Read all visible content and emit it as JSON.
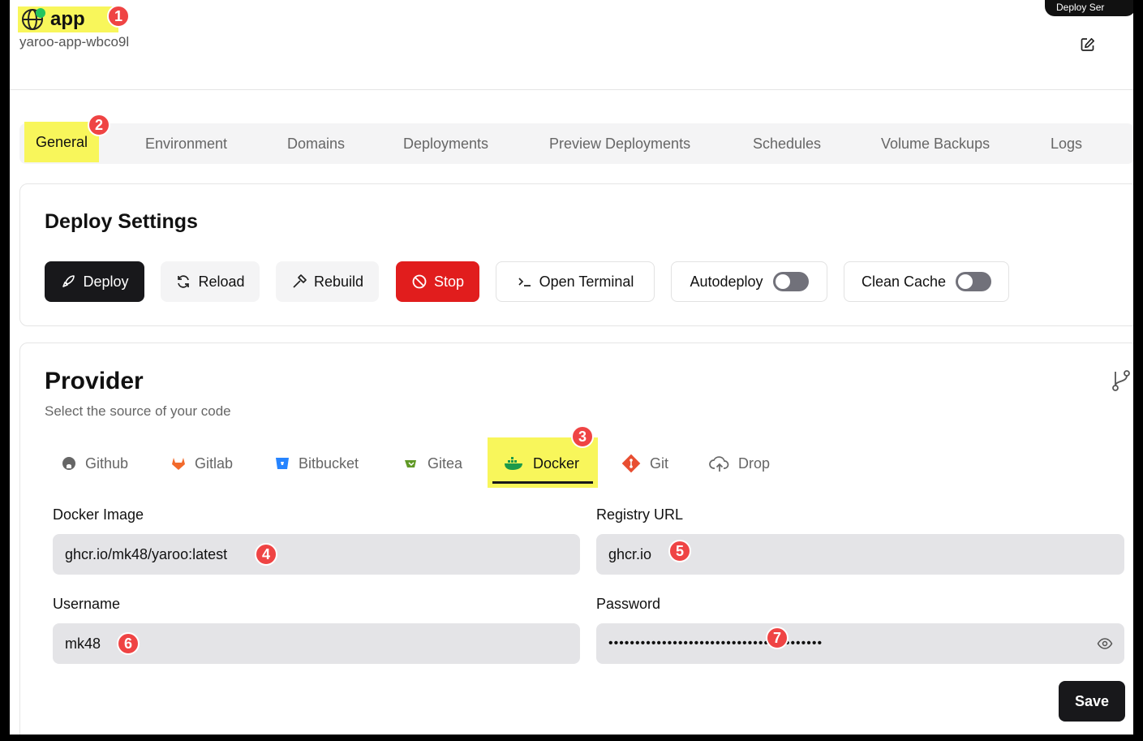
{
  "header": {
    "app_name": "app",
    "app_slug": "yaroo-app-wbco9l",
    "corner_label": "Deploy Ser"
  },
  "annotations": [
    "1",
    "2",
    "3",
    "4",
    "5",
    "6",
    "7"
  ],
  "tabs": [
    "General",
    "Environment",
    "Domains",
    "Deployments",
    "Preview Deployments",
    "Schedules",
    "Volume Backups",
    "Logs"
  ],
  "deploy_settings": {
    "title": "Deploy Settings",
    "deploy": "Deploy",
    "reload": "Reload",
    "rebuild": "Rebuild",
    "stop": "Stop",
    "open_terminal": "Open Terminal",
    "autodeploy": "Autodeploy",
    "clean_cache": "Clean Cache"
  },
  "provider": {
    "title": "Provider",
    "subtitle": "Select the source of your code",
    "tabs": [
      "Github",
      "Gitlab",
      "Bitbucket",
      "Gitea",
      "Docker",
      "Git",
      "Drop"
    ],
    "active_tab": "Docker"
  },
  "form": {
    "docker_image_label": "Docker Image",
    "docker_image_value": "ghcr.io/mk48/yaroo:latest",
    "registry_url_label": "Registry URL",
    "registry_url_value": "ghcr.io",
    "username_label": "Username",
    "username_value": "mk48",
    "password_label": "Password",
    "password_value": "••••••••••••••••••••••••••••••••••••••••",
    "save": "Save"
  },
  "colors": {
    "highlight": "#f8f65b",
    "badge": "#ef4444",
    "stop": "#e11d1d",
    "primary": "#18181b"
  }
}
